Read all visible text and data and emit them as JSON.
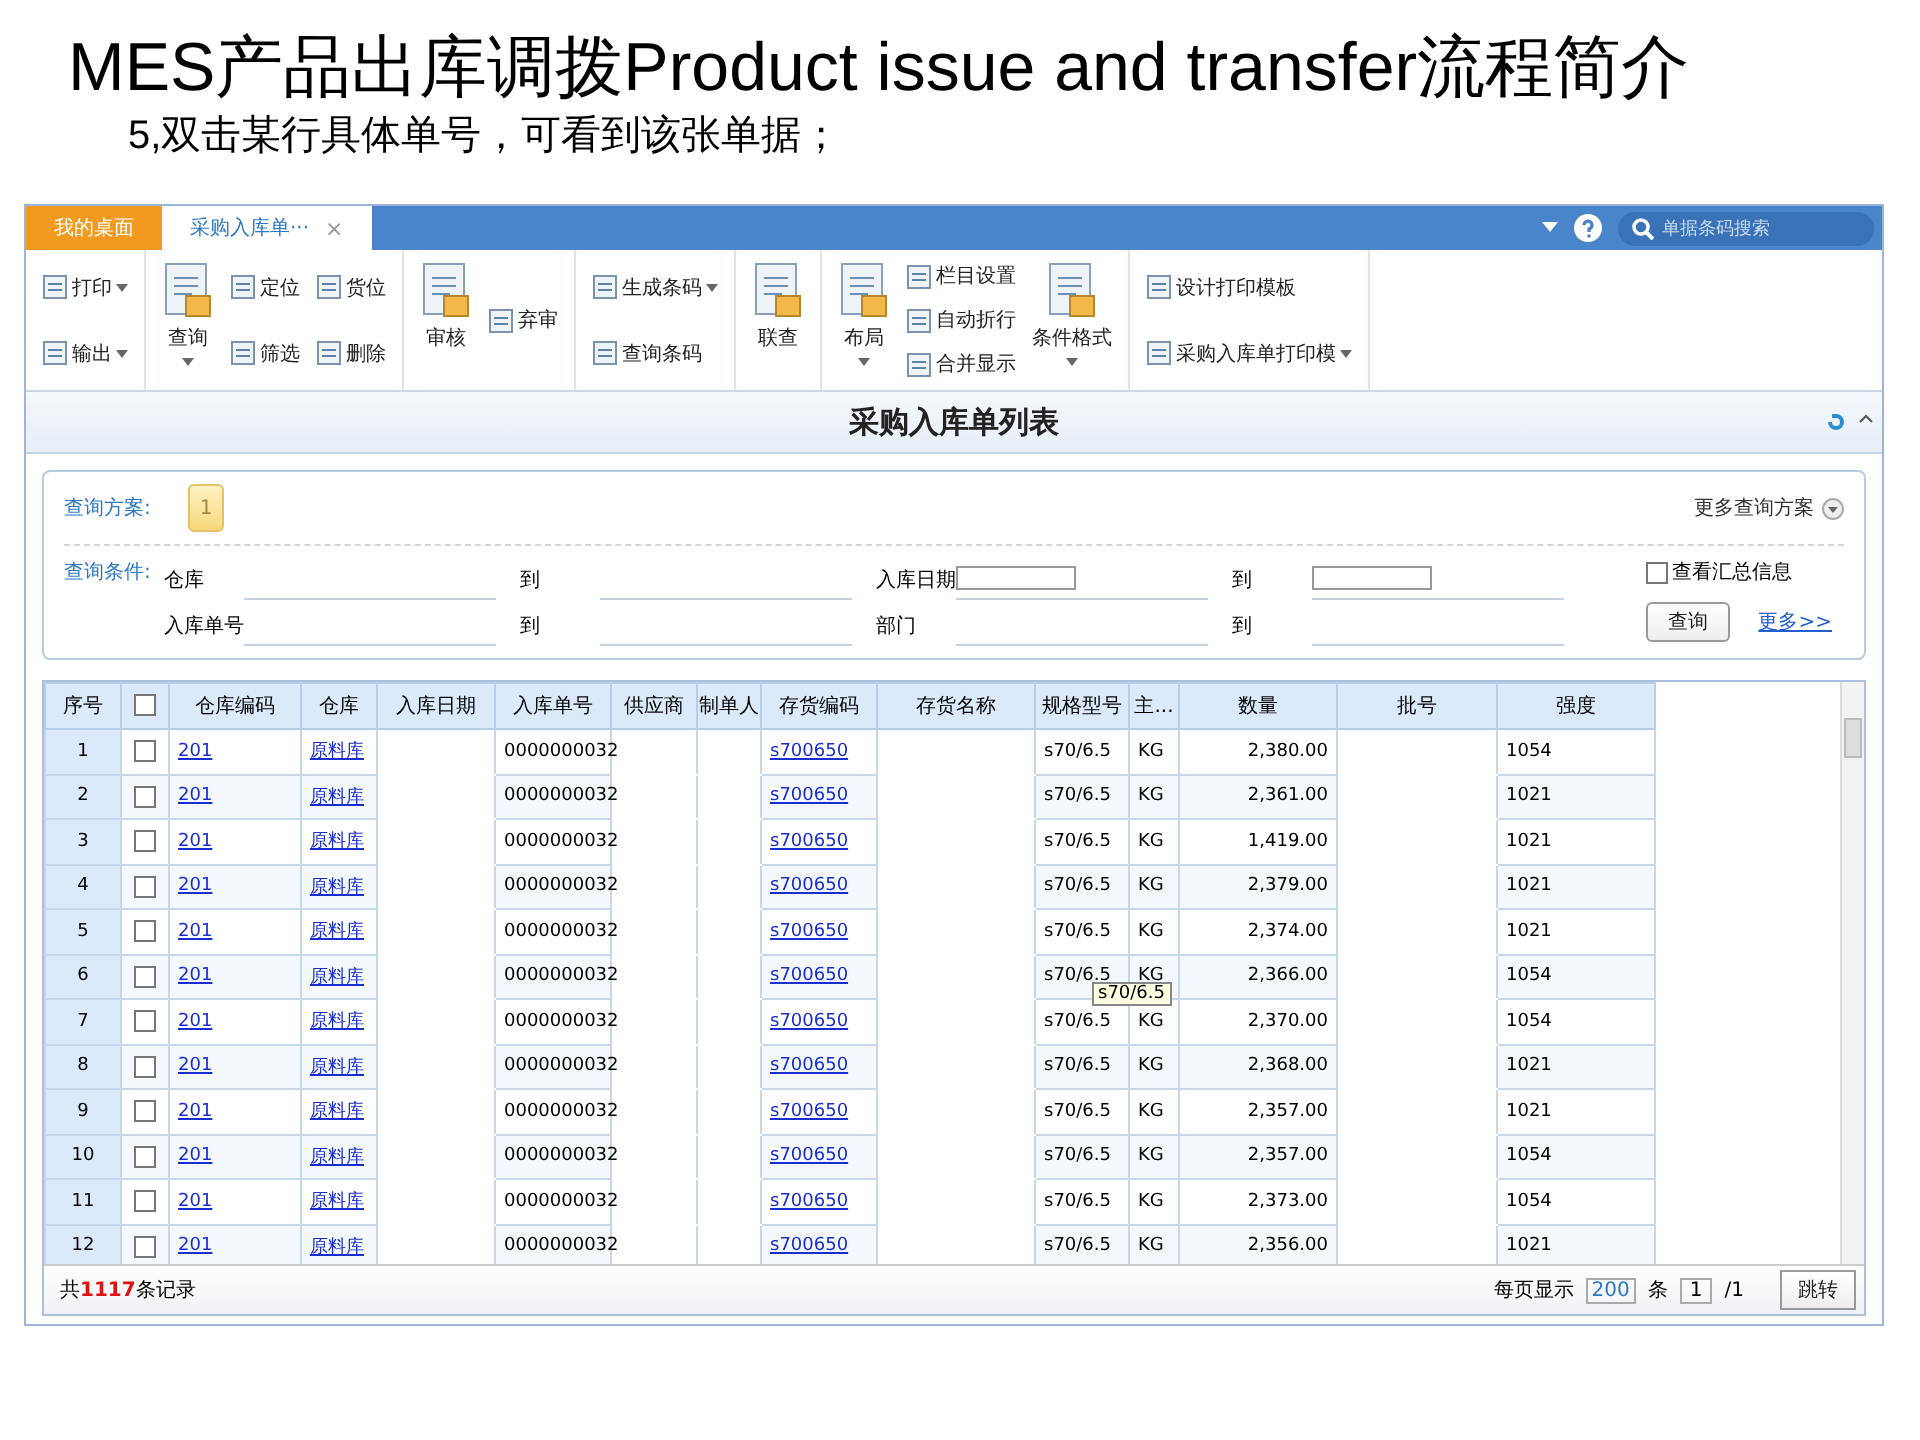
{
  "slide": {
    "title": "MES产品出库调拨Product issue and transfer流程简介",
    "subtitle": "5,双击某行具体单号，可看到该张单据；"
  },
  "tabs": [
    {
      "label": "我的桌面",
      "selected": false
    },
    {
      "label": "采购入库单···",
      "selected": true,
      "close": "×"
    }
  ],
  "search": {
    "placeholder": "单据条码搜索"
  },
  "toolbar": [
    [
      {
        "kind": "stack",
        "items": [
          {
            "label": "打印",
            "dropdown": true
          },
          {
            "label": "输出",
            "dropdown": true
          }
        ]
      }
    ],
    [
      {
        "kind": "big",
        "label": "查询",
        "dropdown": true
      },
      {
        "kind": "stack",
        "items": [
          {
            "label": "定位",
            "dropdown": false
          },
          {
            "label": "筛选",
            "dropdown": false
          }
        ]
      },
      {
        "kind": "stack",
        "items": [
          {
            "label": "货位",
            "dropdown": false
          },
          {
            "label": "删除",
            "dropdown": false
          }
        ]
      }
    ],
    [
      {
        "kind": "big",
        "label": "审核",
        "dropdown": false
      },
      {
        "kind": "stack",
        "items": [
          {
            "label": "弃审",
            "dropdown": false
          }
        ]
      }
    ],
    [
      {
        "kind": "stack",
        "items": [
          {
            "label": "生成条码",
            "dropdown": true
          },
          {
            "label": "查询条码",
            "dropdown": false
          }
        ]
      }
    ],
    [
      {
        "kind": "big",
        "label": "联查",
        "dropdown": false
      }
    ],
    [
      {
        "kind": "big",
        "label": "布局",
        "dropdown": true
      },
      {
        "kind": "stack",
        "items": [
          {
            "label": "栏目设置",
            "dropdown": false
          },
          {
            "label": "自动折行",
            "dropdown": false
          },
          {
            "label": "合并显示",
            "dropdown": false
          }
        ]
      },
      {
        "kind": "big",
        "label": "条件格式",
        "dropdown": true
      }
    ],
    [
      {
        "kind": "stack",
        "items": [
          {
            "label": "设计打印模板",
            "dropdown": false
          },
          {
            "label": "采购入库单打印模",
            "dropdown": true
          }
        ]
      }
    ]
  ],
  "list_title": "采购入库单列表",
  "query": {
    "scheme_label": "查询方案:",
    "scheme_button": "1",
    "more_schemes": "更多查询方案",
    "conditions_label": "查询条件:",
    "fields": [
      {
        "label": "仓库",
        "kind": "line"
      },
      {
        "label": "到",
        "kind": "line"
      },
      {
        "label": "入库日期",
        "kind": "box"
      },
      {
        "label": "到",
        "kind": "box"
      },
      {
        "label": "入库单号",
        "kind": "line"
      },
      {
        "label": "到",
        "kind": "line"
      },
      {
        "label": "部门",
        "kind": "line"
      },
      {
        "label": "到",
        "kind": "line"
      }
    ],
    "summary": {
      "label": "查看汇总信息",
      "checked": false
    },
    "query_button": "查询",
    "more_link": "更多>>"
  },
  "table": {
    "header_checked": false,
    "columns": [
      "序号",
      "仓库编码",
      "仓库",
      "入库日期",
      "入库单号",
      "供应商",
      "制单人",
      "存货编码",
      "存货名称",
      "规格型号",
      "主...",
      "数量",
      "批号",
      "强度"
    ],
    "rows": [
      {
        "no": "1",
        "checked": false,
        "wh_code": "201",
        "warehouse": "原料库",
        "receipt_no": "0000000032",
        "item_code": "s700650",
        "spec": "s70/6.5",
        "unit": "KG",
        "qty": "2,380.00",
        "strength": "1054"
      },
      {
        "no": "2",
        "checked": false,
        "wh_code": "201",
        "warehouse": "原料库",
        "receipt_no": "0000000032",
        "item_code": "s700650",
        "spec": "s70/6.5",
        "unit": "KG",
        "qty": "2,361.00",
        "strength": "1021"
      },
      {
        "no": "3",
        "checked": false,
        "wh_code": "201",
        "warehouse": "原料库",
        "receipt_no": "0000000032",
        "item_code": "s700650",
        "spec": "s70/6.5",
        "unit": "KG",
        "qty": "1,419.00",
        "strength": "1021"
      },
      {
        "no": "4",
        "checked": false,
        "wh_code": "201",
        "warehouse": "原料库",
        "receipt_no": "0000000032",
        "item_code": "s700650",
        "spec": "s70/6.5",
        "unit": "KG",
        "qty": "2,379.00",
        "strength": "1021"
      },
      {
        "no": "5",
        "checked": false,
        "wh_code": "201",
        "warehouse": "原料库",
        "receipt_no": "0000000032",
        "item_code": "s700650",
        "spec": "s70/6.5",
        "unit": "KG",
        "qty": "2,374.00",
        "strength": "1021"
      },
      {
        "no": "6",
        "checked": false,
        "wh_code": "201",
        "warehouse": "原料库",
        "receipt_no": "0000000032",
        "item_code": "s700650",
        "spec": "s70/6.5",
        "unit": "KG",
        "qty": "2,366.00",
        "strength": "1054"
      },
      {
        "no": "7",
        "checked": false,
        "wh_code": "201",
        "warehouse": "原料库",
        "receipt_no": "0000000032",
        "item_code": "s700650",
        "spec": "s70/6.5",
        "unit": "KG",
        "qty": "2,370.00",
        "strength": "1054"
      },
      {
        "no": "8",
        "checked": false,
        "wh_code": "201",
        "warehouse": "原料库",
        "receipt_no": "0000000032",
        "item_code": "s700650",
        "spec": "s70/6.5",
        "unit": "KG",
        "qty": "2,368.00",
        "strength": "1021"
      },
      {
        "no": "9",
        "checked": false,
        "wh_code": "201",
        "warehouse": "原料库",
        "receipt_no": "0000000032",
        "item_code": "s700650",
        "spec": "s70/6.5",
        "unit": "KG",
        "qty": "2,357.00",
        "strength": "1021"
      },
      {
        "no": "10",
        "checked": false,
        "wh_code": "201",
        "warehouse": "原料库",
        "receipt_no": "0000000032",
        "item_code": "s700650",
        "spec": "s70/6.5",
        "unit": "KG",
        "qty": "2,357.00",
        "strength": "1054"
      },
      {
        "no": "11",
        "checked": false,
        "wh_code": "201",
        "warehouse": "原料库",
        "receipt_no": "0000000032",
        "item_code": "s700650",
        "spec": "s70/6.5",
        "unit": "KG",
        "qty": "2,373.00",
        "strength": "1054"
      },
      {
        "no": "12",
        "checked": false,
        "wh_code": "201",
        "warehouse": "原料库",
        "receipt_no": "0000000032",
        "item_code": "s700650",
        "spec": "s70/6.5",
        "unit": "KG",
        "qty": "2,356.00",
        "strength": "1021"
      }
    ],
    "tooltip": "s70/6.5"
  },
  "footer": {
    "total": "共**1117**条记录",
    "per_page_label": "每页显示",
    "per_page": "200",
    "per_page_unit": "条",
    "page": "1",
    "page_total": "/1",
    "jump_button": "跳转"
  }
}
